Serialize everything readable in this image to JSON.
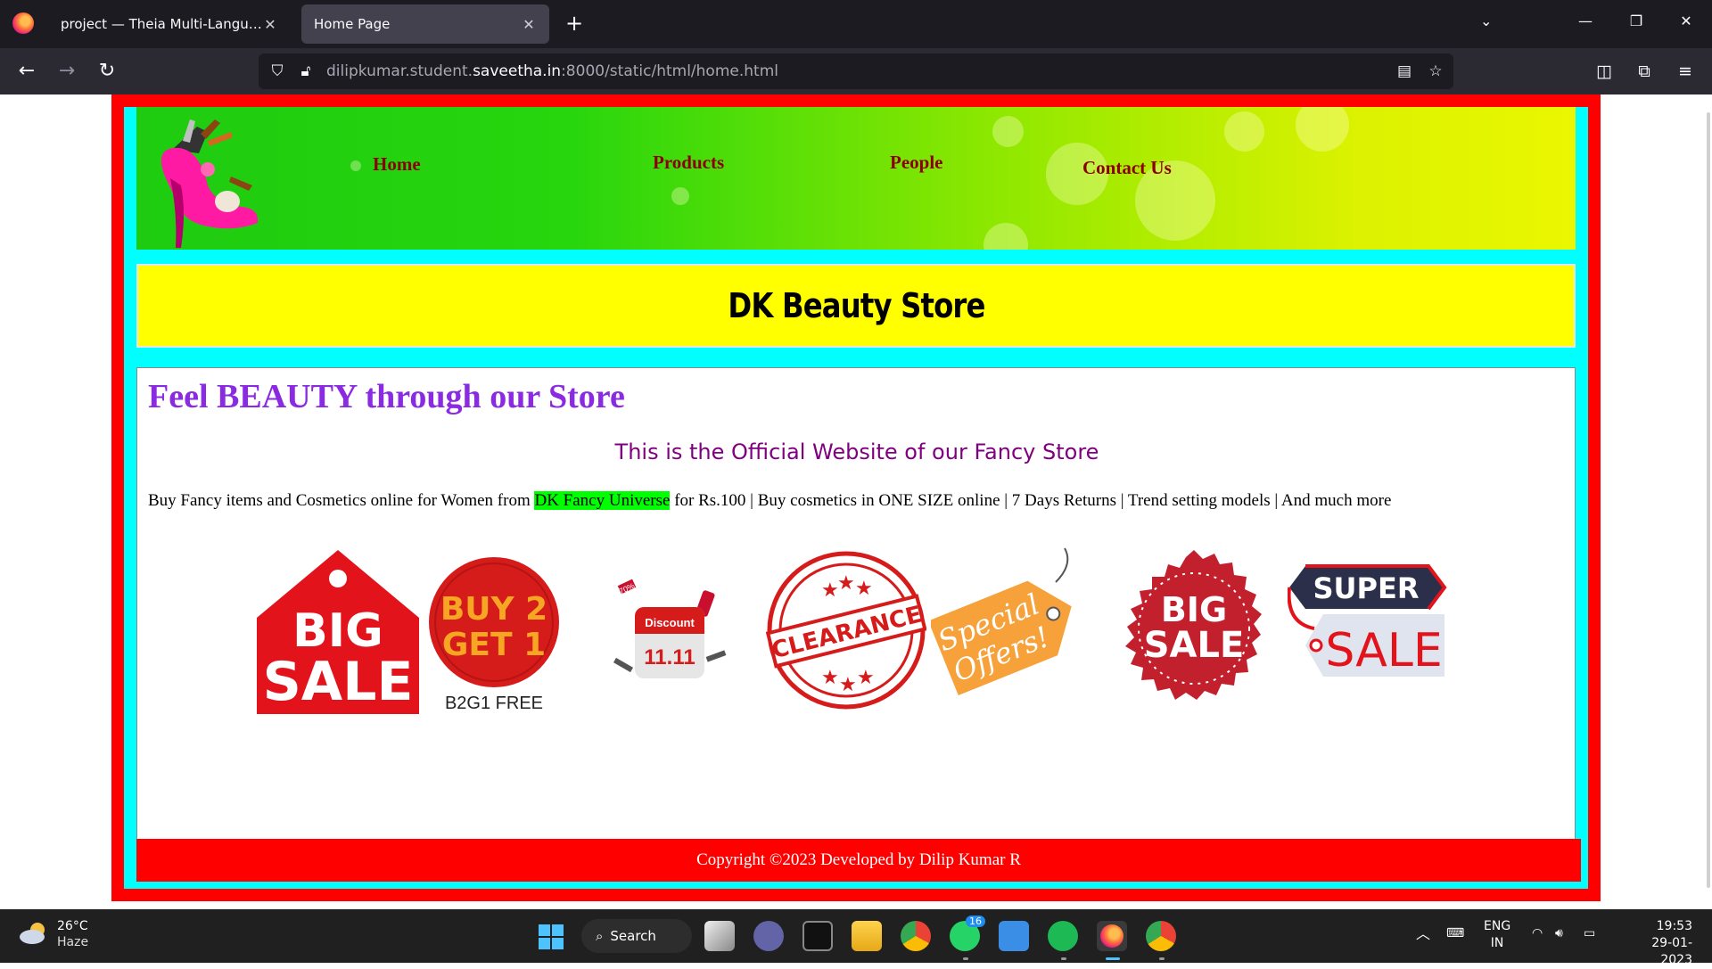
{
  "browser": {
    "tabs": [
      {
        "title": "project — Theia Multi-Language Ex",
        "active": false
      },
      {
        "title": "Home Page",
        "active": true
      }
    ],
    "url_prefix": "dilipkumar.student.",
    "url_domain": "saveetha.in",
    "url_suffix": ":8000/static/html/home.html"
  },
  "site": {
    "nav": [
      "Home",
      "Products",
      "People",
      "Contact Us"
    ],
    "store_name": "DK Beauty Store",
    "tagline": "Feel BEAUTY through our Store",
    "official": "This is the Official Website of our Fancy Store",
    "desc_before": "Buy Fancy items and Cosmetics online for Women from ",
    "desc_highlight": "DK Fancy Universe",
    "desc_after": " for Rs.100 | Buy cosmetics in ONE SIZE online | 7 Days Returns | Trend setting models | And much more",
    "badges": {
      "big_sale_1": [
        "BIG",
        "SALE"
      ],
      "buy2get1": [
        "BUY 2",
        "GET 1",
        "B2G1 FREE"
      ],
      "discount": [
        "Discount",
        "11.11",
        "70%"
      ],
      "clearance": "CLEARANCE",
      "special": [
        "Special",
        "Offers!"
      ],
      "big_sale_2": [
        "BIG",
        "SALE"
      ],
      "super_sale": [
        "SUPER",
        "SALE"
      ]
    },
    "footer": "Copyright ©2023 Developed by Dilip Kumar R"
  },
  "taskbar": {
    "weather_temp": "26°C",
    "weather_desc": "Haze",
    "search_label": "Search",
    "whatsapp_badge": "16",
    "lang": "ENG",
    "region": "IN",
    "time": "19:53",
    "date": "29-01-2023"
  },
  "colors": {
    "page_border": "#ff0000",
    "inner_bg": "#00ffff",
    "store_band": "#ffff00",
    "tagline": "#8a2be2",
    "official": "#800080",
    "nav_link": "#8b0000",
    "highlight": "#00ff00"
  }
}
